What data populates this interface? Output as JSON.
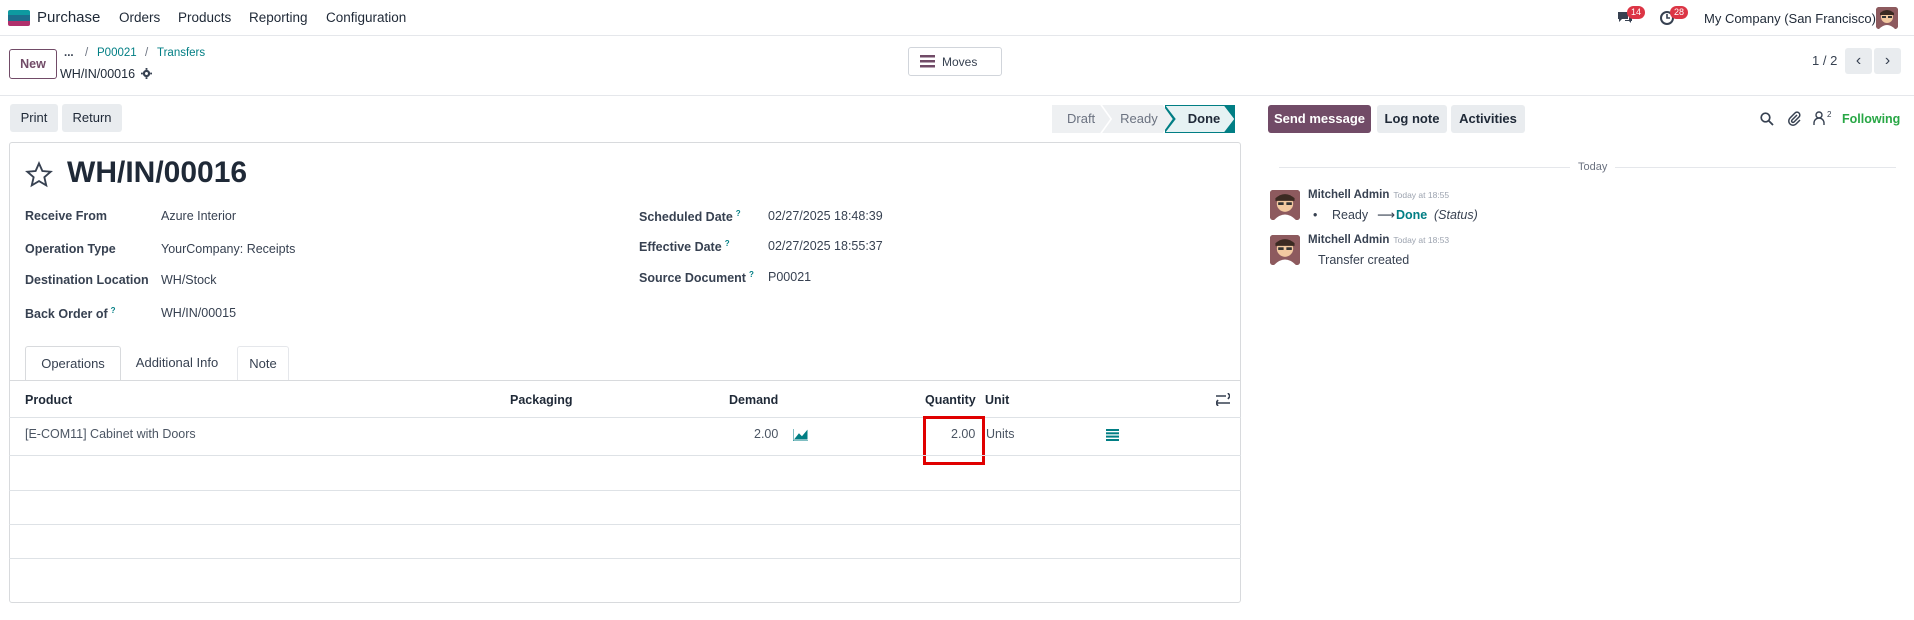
{
  "topbar": {
    "app_name": "Purchase",
    "menu": [
      "Orders",
      "Products",
      "Reporting",
      "Configuration"
    ],
    "messages_badge": "14",
    "activities_badge": "28",
    "company": "My Company (San Francisco)"
  },
  "control_panel": {
    "new_label": "New",
    "breadcrumb_more": "...",
    "breadcrumb": [
      "P00021",
      "Transfers"
    ],
    "record_name": "WH/IN/00016",
    "moves_label": "Moves",
    "pager": "1 / 2"
  },
  "actions": {
    "print": "Print",
    "return": "Return"
  },
  "statusbar": [
    "Draft",
    "Ready",
    "Done"
  ],
  "form": {
    "title": "WH/IN/00016",
    "receive_from_label": "Receive From",
    "receive_from": "Azure Interior",
    "operation_type_label": "Operation Type",
    "operation_type": "YourCompany: Receipts",
    "destination_location_label": "Destination Location",
    "destination_location": "WH/Stock",
    "back_order_label": "Back Order of",
    "back_order": "WH/IN/00015",
    "scheduled_date_label": "Scheduled Date",
    "scheduled_date": "02/27/2025 18:48:39",
    "effective_date_label": "Effective Date",
    "effective_date": "02/27/2025 18:55:37",
    "source_document_label": "Source Document",
    "source_document": "P00021",
    "help_mark": "?"
  },
  "tabs": [
    "Operations",
    "Additional Info",
    "Note"
  ],
  "table": {
    "headers": {
      "product": "Product",
      "packaging": "Packaging",
      "demand": "Demand",
      "quantity": "Quantity",
      "unit": "Unit"
    },
    "rows": [
      {
        "product": "[E-COM11] Cabinet with Doors",
        "packaging": "",
        "demand": "2.00",
        "quantity": "2.00",
        "unit": "Units"
      }
    ]
  },
  "chatter": {
    "send_message": "Send message",
    "log_note": "Log note",
    "activities": "Activities",
    "followers_count": "2",
    "following": "Following",
    "date_separator": "Today",
    "messages": [
      {
        "author": "Mitchell Admin",
        "time": "Today at 18:55",
        "old": "Ready",
        "new": "Done",
        "field": "(Status)"
      },
      {
        "author": "Mitchell Admin",
        "time": "Today at 18:53",
        "body": "Transfer created"
      }
    ]
  },
  "colors": {
    "brand": "#714b67",
    "link": "#017e84",
    "highlight": "#e00000",
    "following": "#28a745"
  }
}
